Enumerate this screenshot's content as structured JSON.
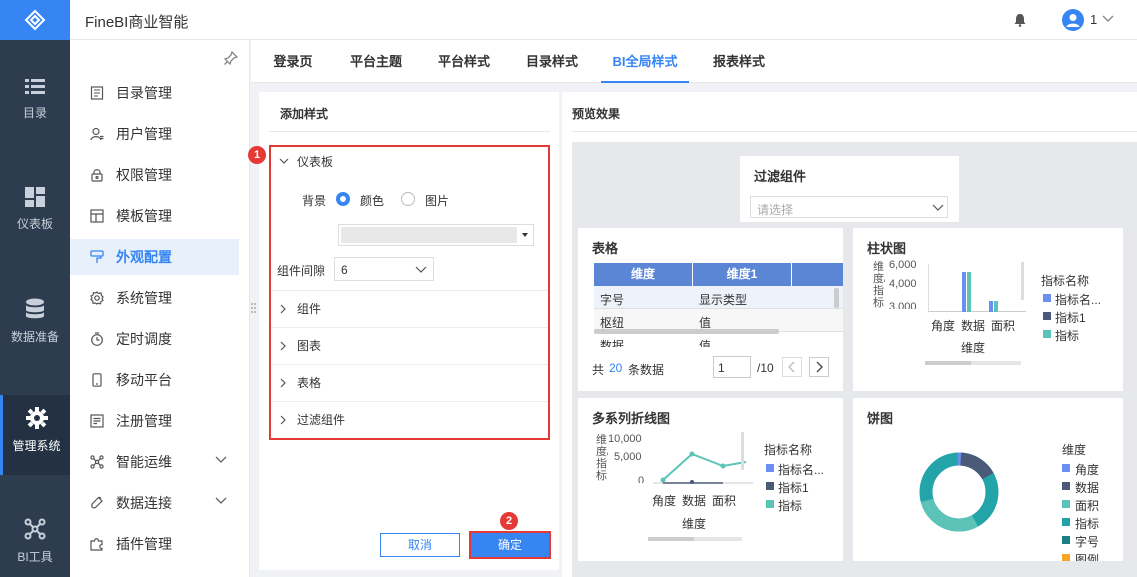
{
  "header": {
    "title": "FineBI商业智能",
    "user_label": "1"
  },
  "rail": {
    "items": [
      {
        "label": "目录",
        "icon": "list-icon"
      },
      {
        "label": "仪表板",
        "icon": "dashboard-icon"
      },
      {
        "label": "数据准备",
        "icon": "database-icon"
      },
      {
        "label": "管理系统",
        "icon": "gear-icon"
      },
      {
        "label": "BI工具",
        "icon": "tools-icon"
      }
    ]
  },
  "sidebar": {
    "items": [
      {
        "label": "目录管理"
      },
      {
        "label": "用户管理"
      },
      {
        "label": "权限管理"
      },
      {
        "label": "模板管理"
      },
      {
        "label": "外观配置"
      },
      {
        "label": "系统管理"
      },
      {
        "label": "定时调度"
      },
      {
        "label": "移动平台"
      },
      {
        "label": "注册管理"
      },
      {
        "label": "智能运维"
      },
      {
        "label": "数据连接"
      },
      {
        "label": "插件管理"
      }
    ]
  },
  "tabs": [
    {
      "label": "登录页"
    },
    {
      "label": "平台主题"
    },
    {
      "label": "平台样式"
    },
    {
      "label": "目录样式"
    },
    {
      "label": "BI全局样式"
    },
    {
      "label": "报表样式"
    }
  ],
  "left_panel": {
    "title": "添加样式",
    "section_dashboard": "仪表板",
    "background_label": "背景",
    "option_color": "颜色",
    "option_image": "图片",
    "spacing_label": "组件间隙",
    "spacing_value": "6",
    "sections": [
      "组件",
      "图表",
      "表格",
      "过滤组件"
    ],
    "cancel": "取消",
    "confirm": "确定",
    "badge1": "1",
    "badge2": "2"
  },
  "preview": {
    "title": "预览效果",
    "filter": {
      "title": "过滤组件",
      "placeholder": "请选择"
    },
    "table": {
      "title": "表格",
      "headers": [
        "维度",
        "维度1"
      ],
      "rows": [
        [
          "字号",
          "显示类型"
        ],
        [
          "枢纽",
          "值"
        ],
        [
          "数据",
          "值"
        ]
      ],
      "footer_prefix": "共",
      "footer_count": "20",
      "footer_suffix": "条数据",
      "page": "1",
      "page_total": "/10"
    },
    "bar": {
      "title": "柱状图",
      "yticks": [
        "6,000",
        "4,000",
        "3,000"
      ],
      "ylabel": "维度/指标",
      "xlabel": "维度",
      "legend_title": "指标名称",
      "legend": [
        "指标名...",
        "指标1",
        "指标"
      ]
    },
    "line": {
      "title": "多系列折线图",
      "yticks": [
        "10,000",
        "5,000",
        "0"
      ],
      "ylabel": "维度/指标",
      "xlabel": "维度",
      "legend_title": "指标名称",
      "legend": [
        "指标名...",
        "指标1",
        "指标"
      ]
    },
    "pie": {
      "title": "饼图",
      "legend_title": "维度",
      "legend": [
        "角度",
        "数据",
        "面积",
        "指标",
        "字号",
        "图例"
      ]
    },
    "categories": [
      "角度",
      "数据",
      "面积"
    ]
  },
  "colors": {
    "accent": "#3685f2",
    "rail": "#2e3c4f",
    "highlight": "#e53935",
    "series1": "#6b8ef0",
    "series2": "#4a5a78",
    "series3": "#5cc3b8"
  }
}
